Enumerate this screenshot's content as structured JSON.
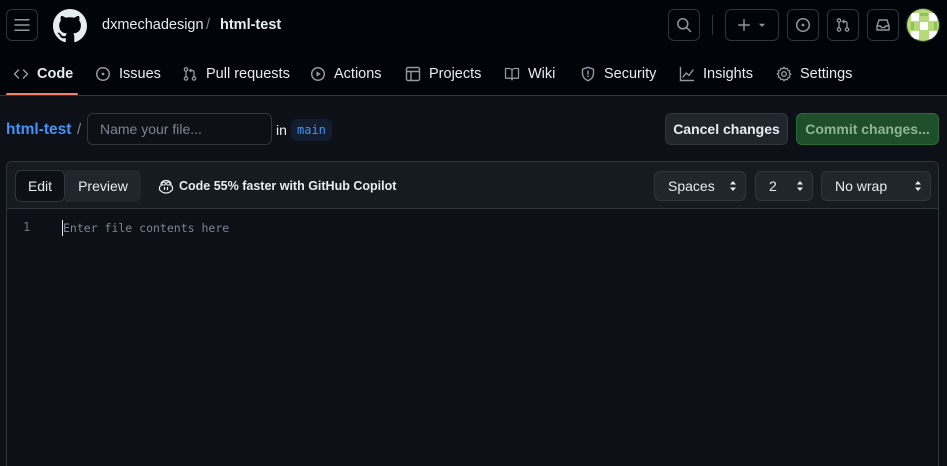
{
  "header": {
    "owner": "dxmechadesign",
    "separator": "/",
    "repo": "html-test"
  },
  "nav": {
    "items": [
      {
        "label": "Code",
        "icon": "code-icon"
      },
      {
        "label": "Issues",
        "icon": "issue-opened-icon"
      },
      {
        "label": "Pull requests",
        "icon": "git-pull-request-icon"
      },
      {
        "label": "Actions",
        "icon": "play-icon"
      },
      {
        "label": "Projects",
        "icon": "table-icon"
      },
      {
        "label": "Wiki",
        "icon": "book-icon"
      },
      {
        "label": "Security",
        "icon": "shield-icon"
      },
      {
        "label": "Insights",
        "icon": "graph-icon"
      },
      {
        "label": "Settings",
        "icon": "gear-icon"
      }
    ],
    "active": "Code"
  },
  "filebar": {
    "repo_link": "html-test",
    "separator": "/",
    "filename_placeholder": "Name your file...",
    "in_label": "in",
    "branch": "main",
    "cancel_label": "Cancel changes",
    "commit_label": "Commit changes..."
  },
  "editor": {
    "tab_edit": "Edit",
    "tab_preview": "Preview",
    "copilot_promo": "Code 55% faster with GitHub Copilot",
    "indent_mode": "Spaces",
    "indent_size": "2",
    "wrap_mode": "No wrap",
    "line_number": "1",
    "content_placeholder": "Enter file contents here"
  },
  "colors": {
    "accent_link": "#4493f8",
    "nav_underline": "#f78166",
    "commit_button": "#1f4f2a",
    "background": "#0d1117"
  }
}
